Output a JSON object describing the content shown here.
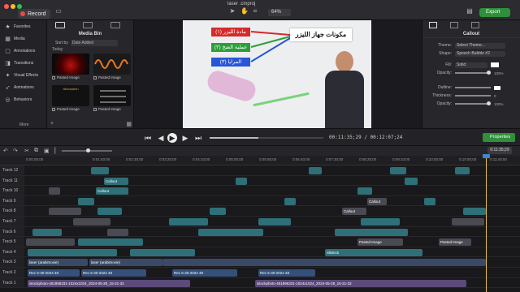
{
  "colors": {
    "accent_green": "#2f8f3a",
    "record_red": "#e84b4b",
    "playhead": "#e8c24c"
  },
  "toolbar": {
    "record_label": "Record",
    "doc_title": "laser .cmproj",
    "zoom_value": "64%",
    "share_label": "Export"
  },
  "leftnav": {
    "items": [
      {
        "label": "Favorites",
        "icon": "star-icon"
      },
      {
        "label": "Media",
        "icon": "media-icon"
      },
      {
        "label": "Annotations",
        "icon": "annotations-icon"
      },
      {
        "label": "Transitions",
        "icon": "transitions-icon"
      },
      {
        "label": "Visual Effects",
        "icon": "visual-effects-icon"
      },
      {
        "label": "Animations",
        "icon": "animations-icon"
      },
      {
        "label": "Behaviors",
        "icon": "behaviors-icon"
      }
    ],
    "more_label": "More"
  },
  "mediabin": {
    "title": "Media Bin",
    "sort_label": "Sort by",
    "sort_value": "Date Added",
    "group_label": "Today",
    "items": [
      {
        "label": "Pasted Image"
      },
      {
        "label": "Pasted Image"
      },
      {
        "label": "Pasted Image"
      },
      {
        "label": "Pasted Image"
      }
    ],
    "absorption_label": "Absorption"
  },
  "video": {
    "title": "مكونات جهاز الليزر",
    "label1": "(١) مادة الليزر",
    "label2": "(٢) عملية الضخ",
    "label3": "(٣) المرايا"
  },
  "props": {
    "title": "Callout",
    "theme_label": "Theme:",
    "theme_value": "Select Theme...",
    "shape_label": "Shape:",
    "shape_value": "Speech Bubble #2",
    "fill_label": "Fill:",
    "fill_value": "Solid",
    "opacity_label": "Opacity:",
    "opacity_value": "100%",
    "outline_label": "Outline:",
    "thickness_label": "Thickness:",
    "thickness_value": "0",
    "opacity2_label": "Opacity:",
    "opacity2_value": "100%"
  },
  "playback": {
    "timecode": "00:11:35;29 / 00:12:07;24",
    "properties_label": "Properties"
  },
  "timeline": {
    "playhead_label": "0:11:35;29",
    "ruler": [
      "0:00:00;00",
      "0:01:40;00",
      "0:02:30;00",
      "0:03:20;00",
      "0:04:10;00",
      "0:05:00;00",
      "0:05:50;00",
      "0:06:40;00",
      "0:07:30;00",
      "0:08:20;00",
      "0:09:10;00",
      "0:10:00;00",
      "0:10:50;00",
      "0:11:40;00"
    ],
    "tracks": [
      "Track 12",
      "Track 11",
      "Track 10",
      "Track 9",
      "Track 8",
      "Track 7",
      "Track 6",
      "Track 5",
      "Track 4",
      "Track 3",
      "Track 2",
      "Track 1"
    ],
    "clip_labels": {
      "callout1": "Callout",
      "callout2": "Callout",
      "callout3": "Callout",
      "callout4": "Callout",
      "pasted1": "Pasted Image",
      "pasted2": "Pasted Image",
      "slide": "Slide15",
      "laser1": "laser (arabimovie)",
      "laser2": "laser (arabimovie)",
      "rec1": "Rec 5-30-2024 48",
      "rec2": "Rec 5-30-2024 48",
      "rec3": "Rec 5-30-2024 48",
      "rec4": "Rec 5-30-2024 48",
      "stock1": "istockphoto-451896331-1024x1024_2024-05-28_15-21-32",
      "stock2": "istockphoto-451896331-1024x1024_2024-05-28_15-21-32"
    }
  }
}
